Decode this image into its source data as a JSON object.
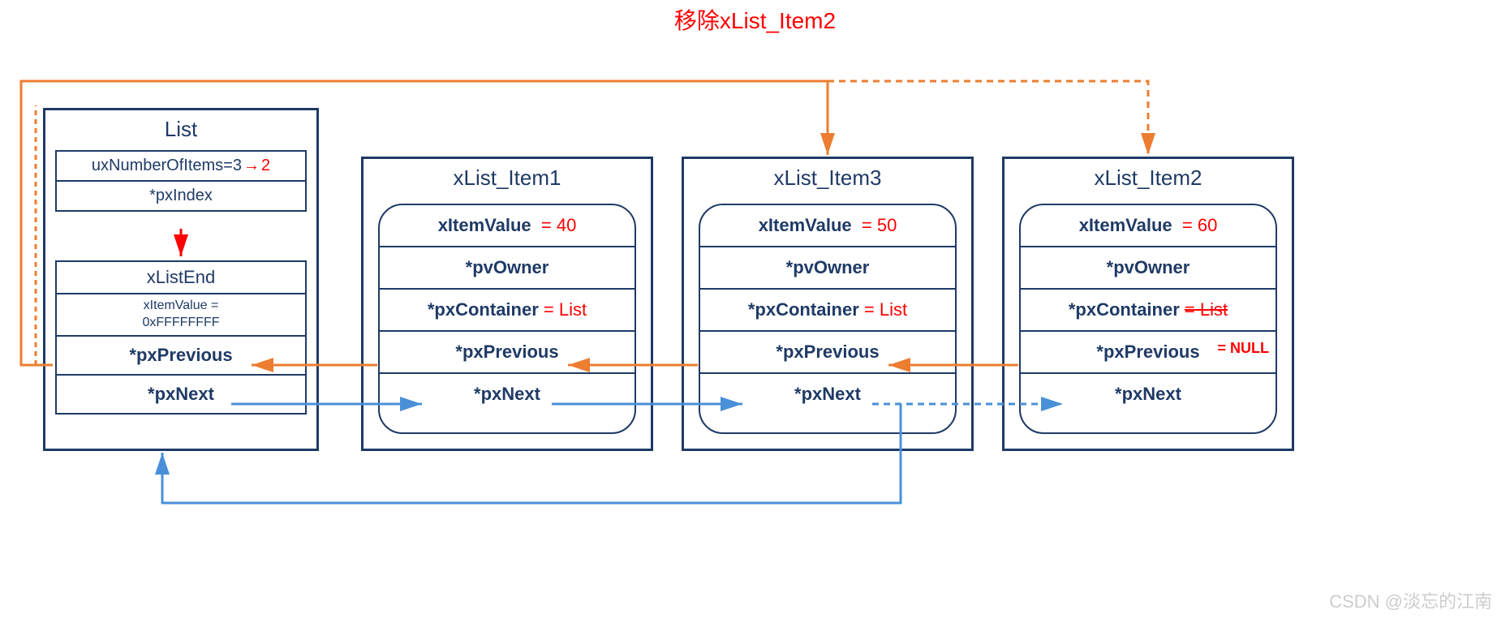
{
  "title": "移除xList_Item2",
  "watermark": "CSDN @淡忘的江南",
  "colors": {
    "navy": "#1f3a66",
    "red": "#ff0000",
    "orange": "#ed7d31",
    "blue": "#4a90d9"
  },
  "list": {
    "title": "List",
    "numberOf_label": "uxNumberOfItems=3",
    "numberOf_new": "2",
    "pxIndex": "*pxIndex",
    "end": {
      "title": "xListEnd",
      "value_label": "xItemValue =",
      "value_hex": "0xFFFFFFFF",
      "pxPrevious": "*pxPrevious",
      "pxNext": "*pxNext"
    }
  },
  "item1": {
    "title": "xList_Item1",
    "value_label": "xItemValue",
    "value": "= 40",
    "pvOwner": "*pvOwner",
    "pxContainer_label": "*pxContainer",
    "pxContainer_val": "= List",
    "pxPrevious": "*pxPrevious",
    "pxNext": "*pxNext"
  },
  "item3": {
    "title": "xList_Item3",
    "value_label": "xItemValue",
    "value": "= 50",
    "pvOwner": "*pvOwner",
    "pxContainer_label": "*pxContainer",
    "pxContainer_val": "= List",
    "pxPrevious": "*pxPrevious",
    "pxNext": "*pxNext"
  },
  "item2": {
    "title": "xList_Item2",
    "value_label": "xItemValue",
    "value": "= 60",
    "pvOwner": "*pvOwner",
    "pxContainer_label": "*pxContainer",
    "pxContainer_val": "= List",
    "pxContainer_new": "= NULL",
    "pxPrevious": "*pxPrevious",
    "pxNext": "*pxNext"
  }
}
